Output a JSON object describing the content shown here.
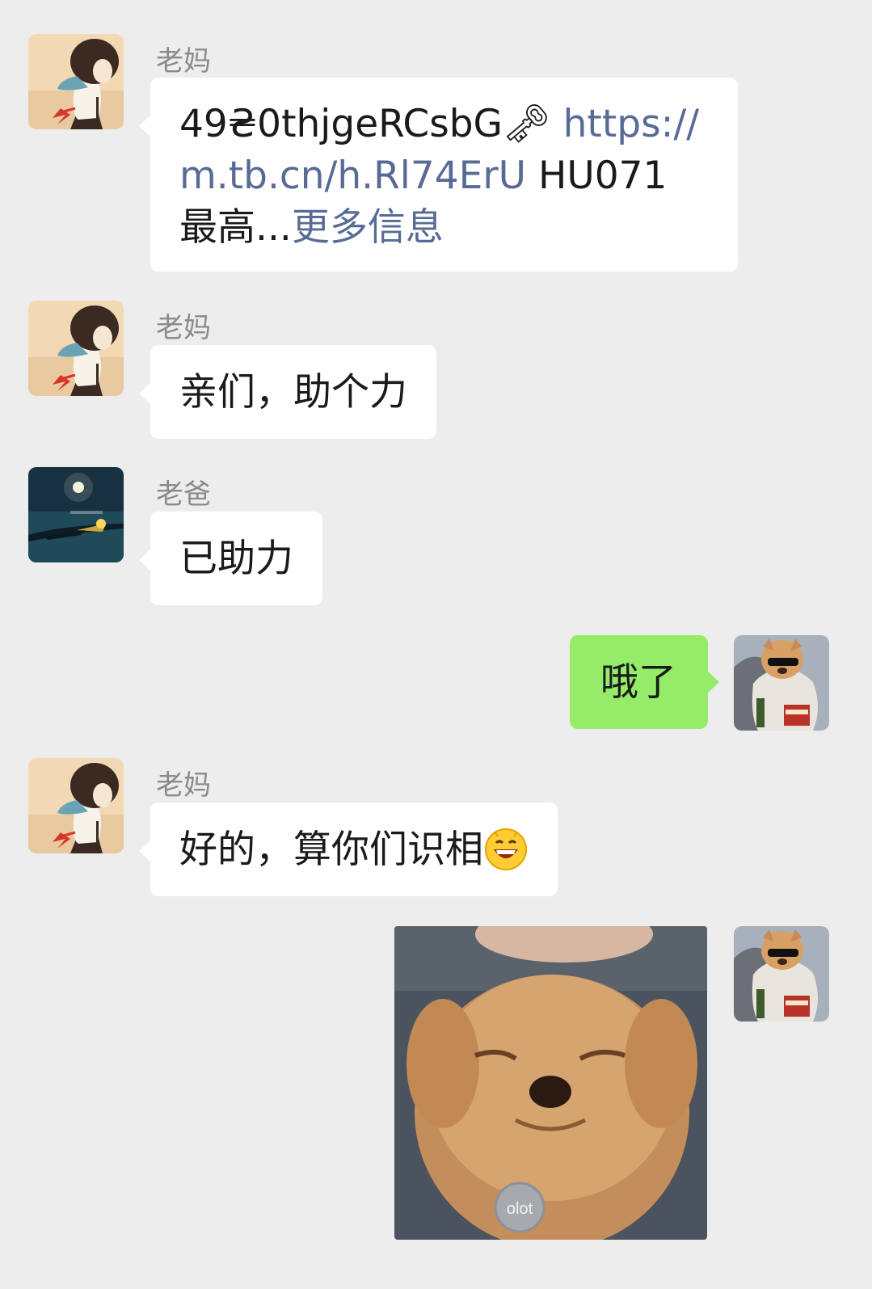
{
  "messages": [
    {
      "sender": "老妈",
      "parts": {
        "code": "49₴0thjgeRCsbG",
        "key_emoji": "🗝",
        "url": "https:// m.tb.cn/h.Rl74ErU",
        "text": " HU071 最高...",
        "more_link": "更多信息"
      }
    },
    {
      "sender": "老妈",
      "text": "亲们，助个力"
    },
    {
      "sender": "老爸",
      "text": "已助力"
    },
    {
      "sender": "me",
      "text": "哦了"
    },
    {
      "sender": "老妈",
      "text": "好的，算你们识相"
    },
    {
      "sender": "me",
      "image": "dog-sticker",
      "image_text": "olot"
    }
  ],
  "icons": {
    "mom_avatar": "girl-avatar",
    "dad_avatar": "night-lake-avatar",
    "me_avatar": "dog-sunglasses-avatar",
    "emoji": "grin-emoji"
  },
  "colors": {
    "background": "#ededed",
    "bubble_left": "#ffffff",
    "bubble_right": "#95ec69",
    "link": "#576b95"
  }
}
